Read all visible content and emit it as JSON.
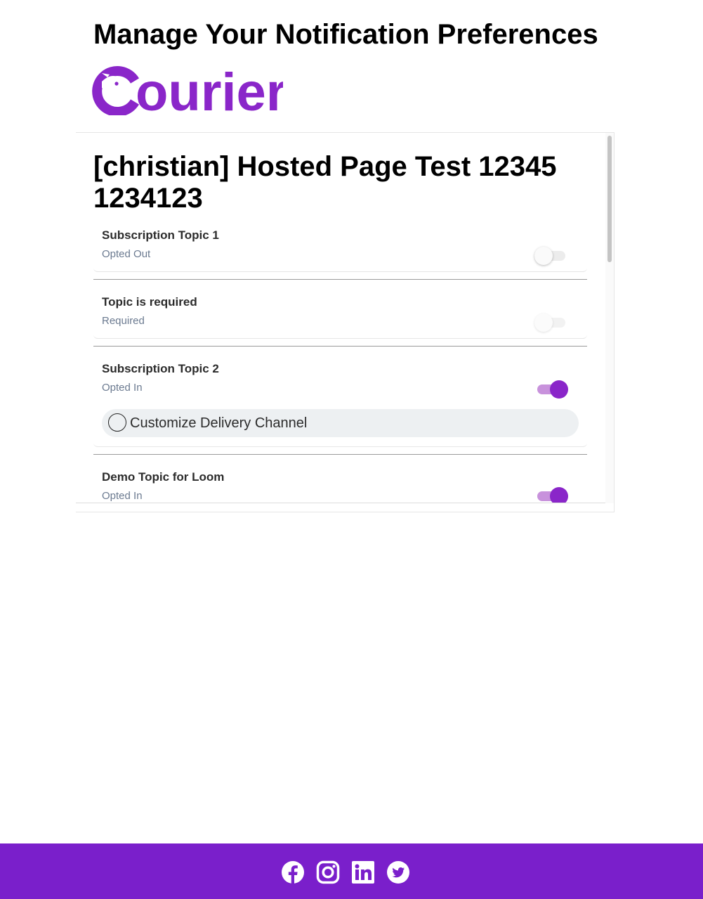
{
  "header": {
    "heading": "Manage Your Notification Preferences",
    "logo_text": "Courier",
    "logo_icon": "courier-bird-logo"
  },
  "colors": {
    "brand": "#8a26c9",
    "footer": "#7a1fcb",
    "toggle_on_track": "#c892dc",
    "status_text": "#6b7a90",
    "pill_bg": "#edf0f2"
  },
  "preferences": {
    "title": "[christian] Hosted Page Test 12345 1234123",
    "topics": [
      {
        "name": "Subscription Topic 1",
        "status": "Opted Out",
        "enabled": false
      },
      {
        "name": "Topic is required",
        "status": "Required",
        "enabled": false,
        "disabled": true
      },
      {
        "name": "Subscription Topic 2",
        "status": "Opted In",
        "enabled": true,
        "customize": {
          "label": "Customize Delivery Channel",
          "checked": false
        }
      },
      {
        "name": "Demo Topic for Loom",
        "status": "Opted In",
        "enabled": true
      }
    ]
  },
  "footer": {
    "social_icons": [
      "facebook-icon",
      "instagram-icon",
      "linkedin-icon",
      "twitter-icon"
    ]
  }
}
